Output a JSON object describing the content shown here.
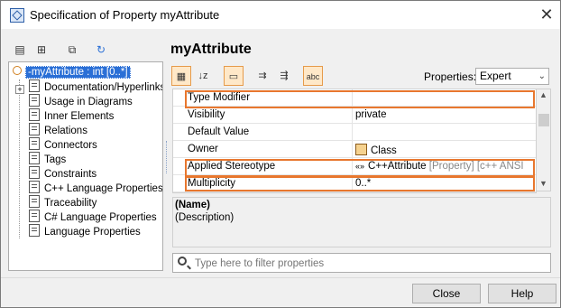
{
  "window": {
    "title": "Specification of Property myAttribute",
    "close_glyph": "✕"
  },
  "tree_toolbar": {
    "icons": [
      "list-icon",
      "tree-icon",
      "copy-icon",
      "refresh-icon"
    ]
  },
  "tree": {
    "root_label": "-myAttribute : int [0..*]",
    "items": [
      "Documentation/Hyperlinks",
      "Usage in Diagrams",
      "Inner Elements",
      "Relations",
      "Connectors",
      "Tags",
      "Constraints",
      "C++ Language Properties",
      "Traceability",
      "C# Language Properties",
      "Language Properties"
    ]
  },
  "heading": "myAttribute",
  "properties_toolbar": {
    "icons": [
      "categorized-icon",
      "sort-az-icon",
      "collapse-icon",
      "expand-icon",
      "collapse-all-icon",
      "abc-icon"
    ]
  },
  "properties_filter": {
    "label": "Properties:",
    "selected": "Expert"
  },
  "grid": {
    "rows": [
      {
        "name": "Type Modifier",
        "value": "",
        "highlighted": true
      },
      {
        "name": "Visibility",
        "value": "private"
      },
      {
        "name": "Default Value",
        "value": ""
      },
      {
        "name": "Owner",
        "value": "Class"
      },
      {
        "name": "Applied Stereotype",
        "value": "C++Attribute",
        "value_extra": "[Property] [c++ ANSI",
        "highlighted": true
      },
      {
        "name": "Multiplicity",
        "value": "0..*",
        "highlighted": true
      }
    ]
  },
  "description": {
    "title": "(Name)",
    "text": "(Description)"
  },
  "filter": {
    "placeholder": "Type here to filter properties"
  },
  "buttons": {
    "close": "Close",
    "help": "Help"
  },
  "colors": {
    "highlight": "#e8772e",
    "selection": "#2a6fd6"
  }
}
